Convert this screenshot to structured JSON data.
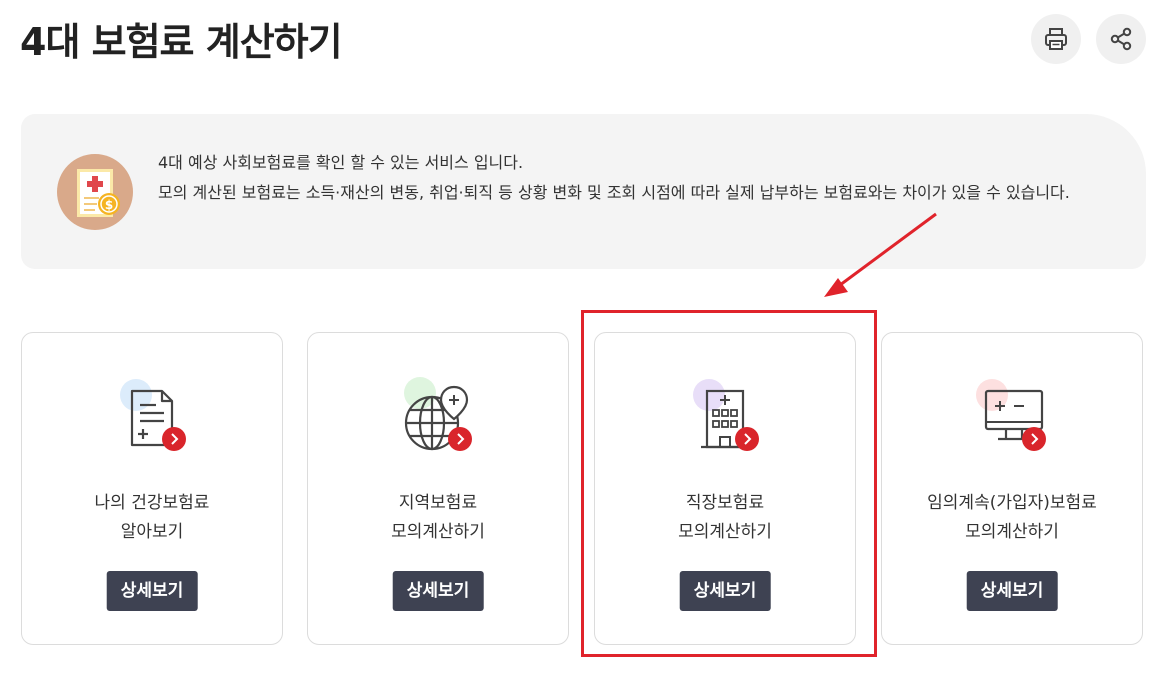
{
  "page": {
    "title": "4대 보험료 계산하기"
  },
  "toolbar": {
    "print_icon": "printer-icon",
    "share_icon": "share-icon"
  },
  "notice": {
    "icon": "insurance-document-coin-icon",
    "line1": "4대 예상 사회보험료를 확인 할 수 있는 서비스 입니다.",
    "line2": "모의 계산된 보험료는 소득·재산의 변동, 취업·퇴직 등 상황 변화 및 조회 시점에 따라 실제 납부하는 보험료와는 차이가 있을 수 있습니다."
  },
  "cards": [
    {
      "icon": "document-plus-icon",
      "line1": "나의 건강보험료",
      "line2": "알아보기",
      "button": "상세보기"
    },
    {
      "icon": "globe-location-icon",
      "line1": "지역보험료",
      "line2": "모의계산하기",
      "button": "상세보기"
    },
    {
      "icon": "office-building-icon",
      "line1": "직장보험료",
      "line2": "모의계산하기",
      "button": "상세보기"
    },
    {
      "icon": "calculator-monitor-icon",
      "line1": "임의계속(가입자)보험료",
      "line2": "모의계산하기",
      "button": "상세보기"
    }
  ],
  "colors": {
    "button_bg": "#3e4252",
    "accent_red": "#d9252b",
    "highlight_red": "#e0232b",
    "notice_bg": "#f4f4f4"
  }
}
